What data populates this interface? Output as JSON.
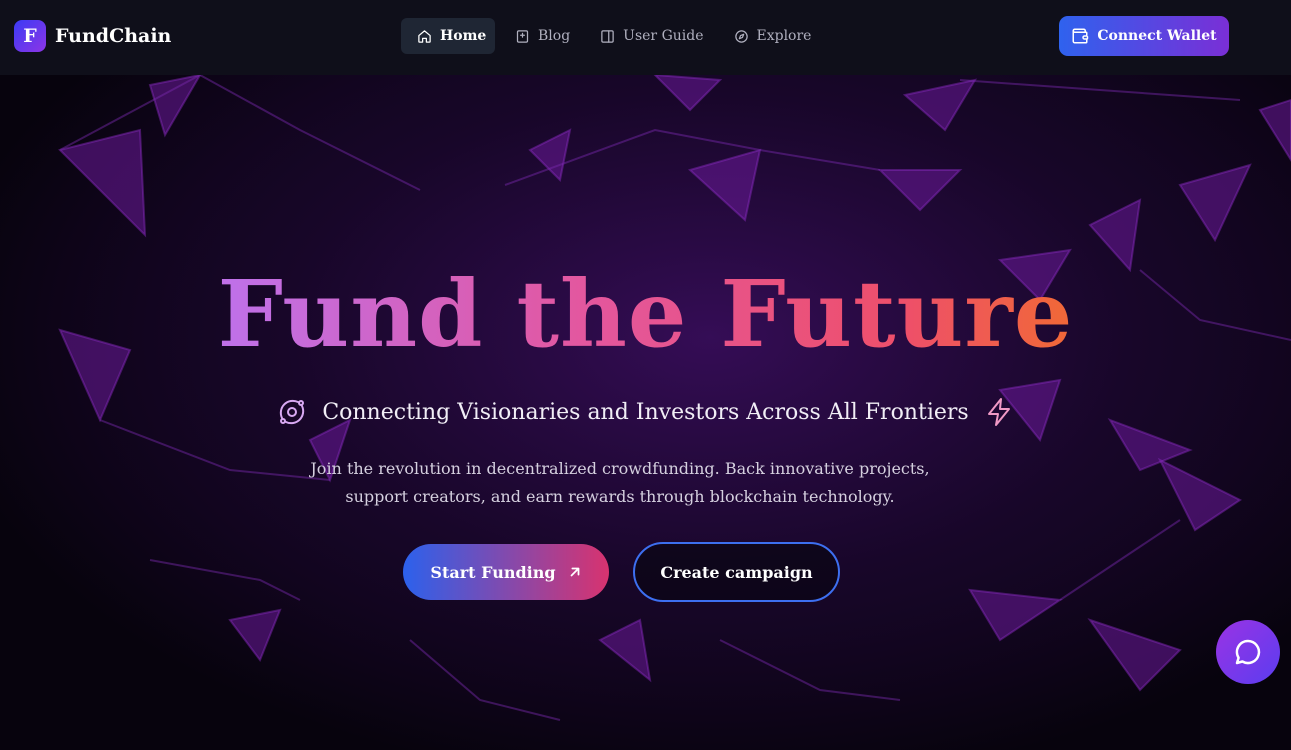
{
  "brand": {
    "logo_letter": "F",
    "name": "FundChain"
  },
  "nav": {
    "items": [
      {
        "label": "Home",
        "icon": "home-icon",
        "active": true
      },
      {
        "label": "Blog",
        "icon": "book-icon",
        "active": false
      },
      {
        "label": "User Guide",
        "icon": "panel-icon",
        "active": false
      },
      {
        "label": "Explore",
        "icon": "compass-icon",
        "active": false
      }
    ],
    "connect_label": "Connect Wallet"
  },
  "hero": {
    "title": "Fund the Future",
    "tagline": "Connecting Visionaries and Investors Across All Frontiers",
    "description_line1": "Join the revolution in decentralized crowdfunding. Back innovative projects,",
    "description_line2": "support creators, and earn rewards through blockchain technology.",
    "primary_label": "Start Funding",
    "secondary_label": "Create campaign"
  },
  "colors": {
    "accent_blue": "#2f62ee",
    "accent_purple": "#7a2fd6",
    "title_gradient": [
      "#c070e8",
      "#e3579f",
      "#f0673a"
    ],
    "nav_bg": "#0f0f1a"
  }
}
